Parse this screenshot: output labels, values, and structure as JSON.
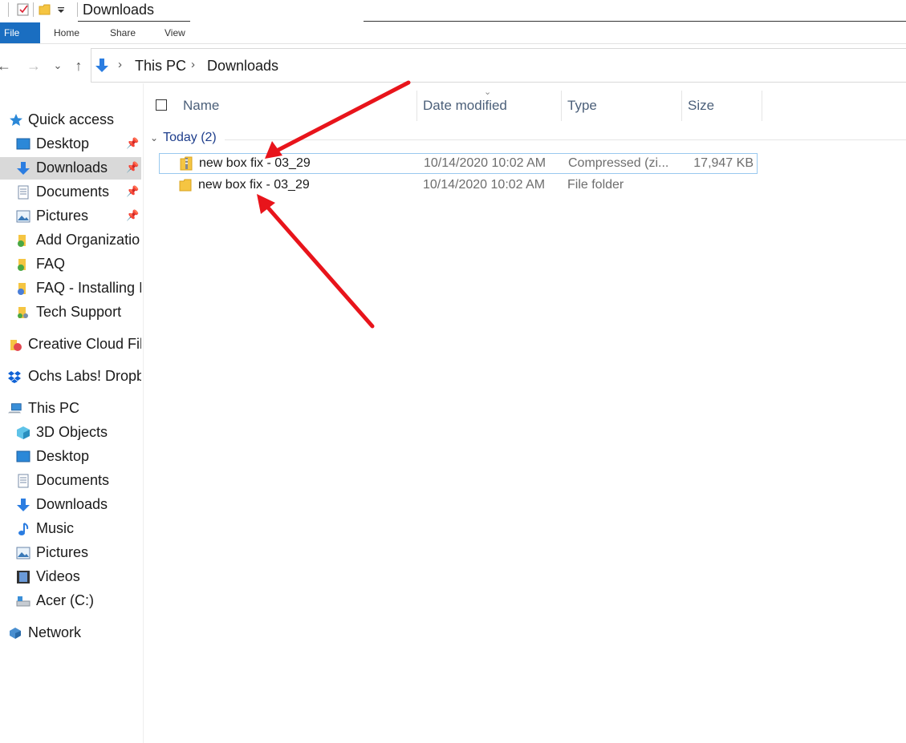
{
  "window": {
    "title": "Downloads"
  },
  "ribbon": {
    "tabs": [
      "File",
      "Home",
      "Share",
      "View"
    ]
  },
  "address": {
    "crumbs": [
      "This PC",
      "Downloads"
    ]
  },
  "sidebar": {
    "quick_access": "Quick access",
    "quick_items": [
      {
        "label": "Desktop",
        "icon": "desktop-icon",
        "pinned": true
      },
      {
        "label": "Downloads",
        "icon": "download-arrow-icon",
        "pinned": true,
        "selected": true
      },
      {
        "label": "Documents",
        "icon": "documents-icon",
        "pinned": true
      },
      {
        "label": "Pictures",
        "icon": "pictures-icon",
        "pinned": true
      },
      {
        "label": "Add Organizatio",
        "icon": "synced-folder-icon"
      },
      {
        "label": "FAQ",
        "icon": "synced-folder-icon"
      },
      {
        "label": "FAQ - Installing I",
        "icon": "synced-folder-icon"
      },
      {
        "label": "Tech Support",
        "icon": "shared-folder-icon"
      }
    ],
    "creative_cloud": "Creative Cloud File",
    "dropbox": "Ochs Labs! Dropb",
    "this_pc": "This PC",
    "pc_items": [
      {
        "label": "3D Objects",
        "icon": "3d-objects-icon"
      },
      {
        "label": "Desktop",
        "icon": "desktop-icon"
      },
      {
        "label": "Documents",
        "icon": "documents-icon"
      },
      {
        "label": "Downloads",
        "icon": "download-arrow-icon"
      },
      {
        "label": "Music",
        "icon": "music-icon"
      },
      {
        "label": "Pictures",
        "icon": "pictures-icon"
      },
      {
        "label": "Videos",
        "icon": "videos-icon"
      },
      {
        "label": "Acer (C:)",
        "icon": "drive-icon"
      }
    ],
    "network": "Network"
  },
  "columns": {
    "name": "Name",
    "date": "Date modified",
    "type": "Type",
    "size": "Size"
  },
  "group": {
    "label": "Today (2)"
  },
  "files": [
    {
      "name": "new box fix - 03_29",
      "date": "10/14/2020 10:02 AM",
      "type": "Compressed (zi...",
      "size": "17,947 KB",
      "icon": "zip-folder-icon"
    },
    {
      "name": "new box fix - 03_29",
      "date": "10/14/2020 10:02 AM",
      "type": "File folder",
      "size": "",
      "icon": "folder-icon"
    }
  ],
  "colors": {
    "accent": "#1a6ec1",
    "annotation": "#e8141b",
    "folder": "#f5c542"
  }
}
